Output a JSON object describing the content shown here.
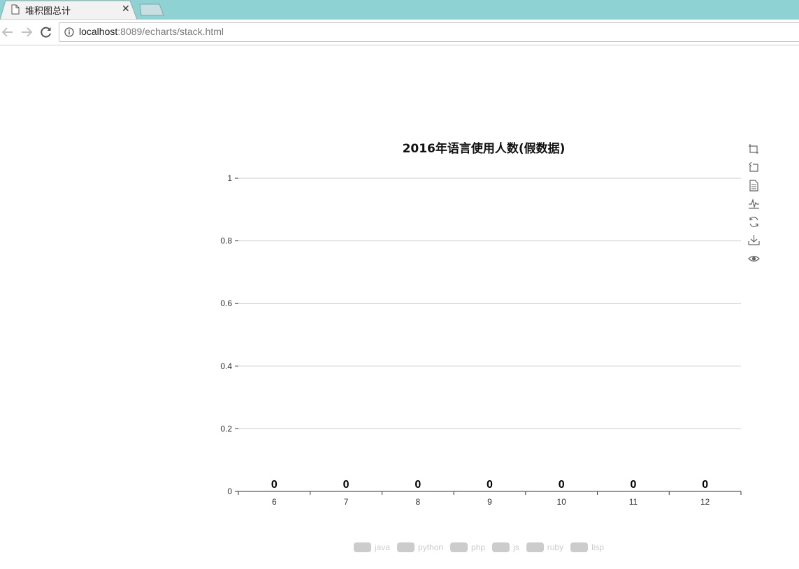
{
  "browser": {
    "tab_title": "堆积图总计",
    "url_host": "localhost",
    "url_rest": ":8089/echarts/stack.html"
  },
  "chart_data": {
    "type": "bar",
    "stacked": true,
    "title": "2016年语言使用人数(假数据)",
    "categories": [
      "6",
      "7",
      "8",
      "9",
      "10",
      "11",
      "12"
    ],
    "series": [
      {
        "name": "java",
        "values": [
          0,
          0,
          0,
          0,
          0,
          0,
          0
        ]
      },
      {
        "name": "python",
        "values": [
          0,
          0,
          0,
          0,
          0,
          0,
          0
        ]
      },
      {
        "name": "php",
        "values": [
          0,
          0,
          0,
          0,
          0,
          0,
          0
        ]
      },
      {
        "name": "js",
        "values": [
          0,
          0,
          0,
          0,
          0,
          0,
          0
        ]
      },
      {
        "name": "ruby",
        "values": [
          0,
          0,
          0,
          0,
          0,
          0,
          0
        ]
      },
      {
        "name": "lisp",
        "values": [
          0,
          0,
          0,
          0,
          0,
          0,
          0
        ]
      }
    ],
    "totals": [
      0,
      0,
      0,
      0,
      0,
      0,
      0
    ],
    "ylim": [
      0,
      1
    ],
    "yticks": [
      "0",
      "0.2",
      "0.4",
      "0.6",
      "0.8",
      "1"
    ],
    "grid": true,
    "legend_position": "bottom-center",
    "legend_inactive_color": "#cccccc"
  },
  "toolbox": [
    "zoom-icon",
    "zoom-reset-icon",
    "data-view-icon",
    "line-chart-icon",
    "restore-icon",
    "save-image-icon",
    "eye-icon"
  ]
}
